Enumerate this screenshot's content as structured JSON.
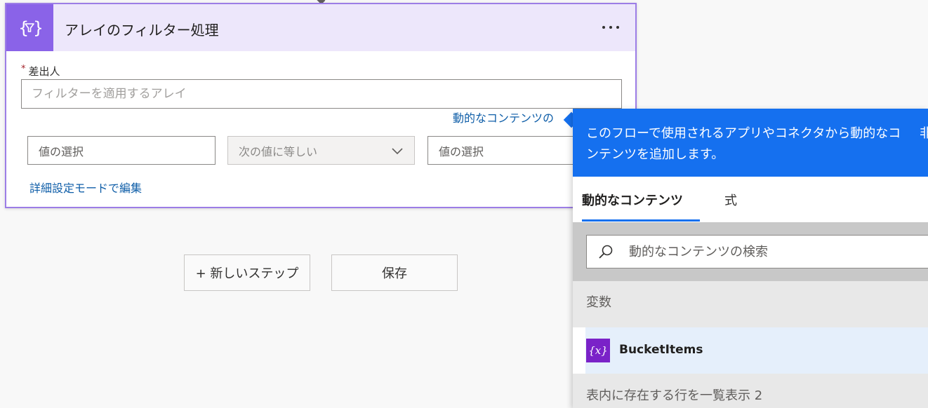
{
  "card": {
    "title": "アレイのフィルター処理",
    "icon": "filter-braces-icon",
    "field_required_mark": "*",
    "field_label": "差出人",
    "array_placeholder": "フィルターを適用するアレイ",
    "dynamic_link": "動的なコンテンツの",
    "condition": {
      "left_placeholder": "値の選択",
      "operator": "次の値に等しい",
      "right_placeholder": "値の選択"
    },
    "advanced_link": "詳細設定モードで編集"
  },
  "buttons": {
    "new_step": "+ 新しいステップ",
    "save": "保存"
  },
  "panel": {
    "banner_text": "このフローで使用されるアプリやコネクタから動的なコンテンツを追加します。",
    "banner_hide": "非",
    "tabs": [
      {
        "label": "動的なコンテンツ",
        "active": true
      },
      {
        "label": "式",
        "active": false
      }
    ],
    "search_placeholder": "動的なコンテンツの検索",
    "sections": [
      {
        "header": "変数",
        "items": [
          {
            "label": "BucketItems",
            "icon_glyph": "{x}"
          }
        ]
      },
      {
        "header": "表内に存在する行を一覧表示 2"
      }
    ]
  },
  "colors": {
    "accent_purple": "#8a63e8",
    "panel_blue": "#1570ef",
    "link_blue": "#0f5ea8",
    "variable_icon": "#7a22c8"
  }
}
